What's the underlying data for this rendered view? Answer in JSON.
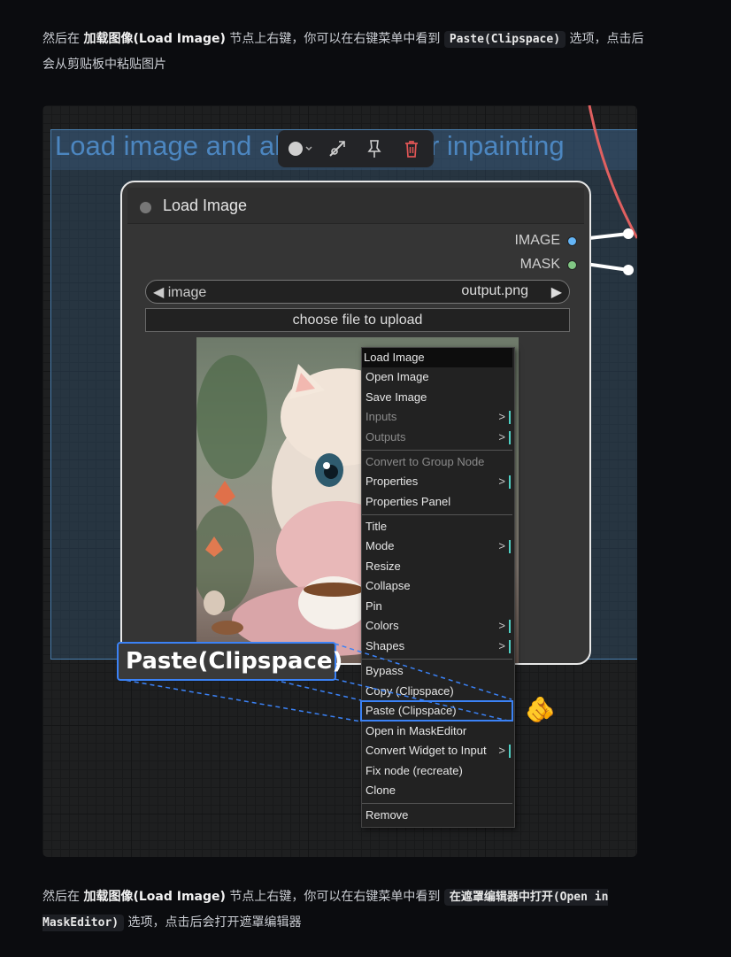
{
  "paragraph1": {
    "prefix": "然后在 ",
    "bold": "加载图像(Load Image)",
    "middle": " 节点上右键，你可以在右键菜单中看到 ",
    "code": "Paste(Clipspace)",
    "suffix": " 选项，点击后会从剪贴板中粘贴图片"
  },
  "paragraph2": {
    "prefix": "然后在 ",
    "bold": "加载图像(Load Image)",
    "middle": " 节点上右键，你可以在右键菜单中看到 ",
    "code": "在遮罩编辑器中打开(Open in MaskEditor)",
    "suffix": " 选项，点击后会打开遮罩编辑器"
  },
  "group_title": "Load image and alpha mask for inpainting",
  "node": {
    "title": "Load Image",
    "outputs": [
      {
        "label": "IMAGE",
        "color": "#64b5f6"
      },
      {
        "label": "MASK",
        "color": "#81c784"
      }
    ],
    "combo_label": "image",
    "combo_value": "output.png",
    "upload_label": "choose file to upload"
  },
  "toolbar_icons": [
    "color-picker-icon",
    "bypass-icon",
    "pin-icon",
    "delete-icon"
  ],
  "context_menu": {
    "items": [
      {
        "label": "Load Image",
        "kind": "title"
      },
      {
        "label": "Open Image"
      },
      {
        "label": "Save Image"
      },
      {
        "label": "Inputs",
        "disabled": true,
        "submenu": true
      },
      {
        "label": "Outputs",
        "disabled": true,
        "submenu": true
      },
      {
        "label": "Convert to Group Node",
        "disabled": true
      },
      {
        "label": "Properties",
        "submenu": true
      },
      {
        "label": "Properties Panel"
      },
      {
        "label": "Title"
      },
      {
        "label": "Mode",
        "submenu": true
      },
      {
        "label": "Resize"
      },
      {
        "label": "Collapse"
      },
      {
        "label": "Pin"
      },
      {
        "label": "Colors",
        "submenu": true
      },
      {
        "label": "Shapes",
        "submenu": true
      },
      {
        "label": "Bypass"
      },
      {
        "label": "Copy (Clipspace)"
      },
      {
        "label": "Paste (Clipspace)",
        "highlighted": true
      },
      {
        "label": "Open in MaskEditor"
      },
      {
        "label": "Convert Widget to Input",
        "submenu": true
      },
      {
        "label": "Fix node (recreate)"
      },
      {
        "label": "Clone"
      },
      {
        "label": "Remove"
      }
    ],
    "submenu_arrow": ">"
  },
  "callout_label": "Paste(Clipspace)",
  "pointer_emoji": "🫵",
  "colors": {
    "accent": "#3b82f6",
    "link_red": "#e06060",
    "submenu_marker": "#4fd1c5"
  }
}
